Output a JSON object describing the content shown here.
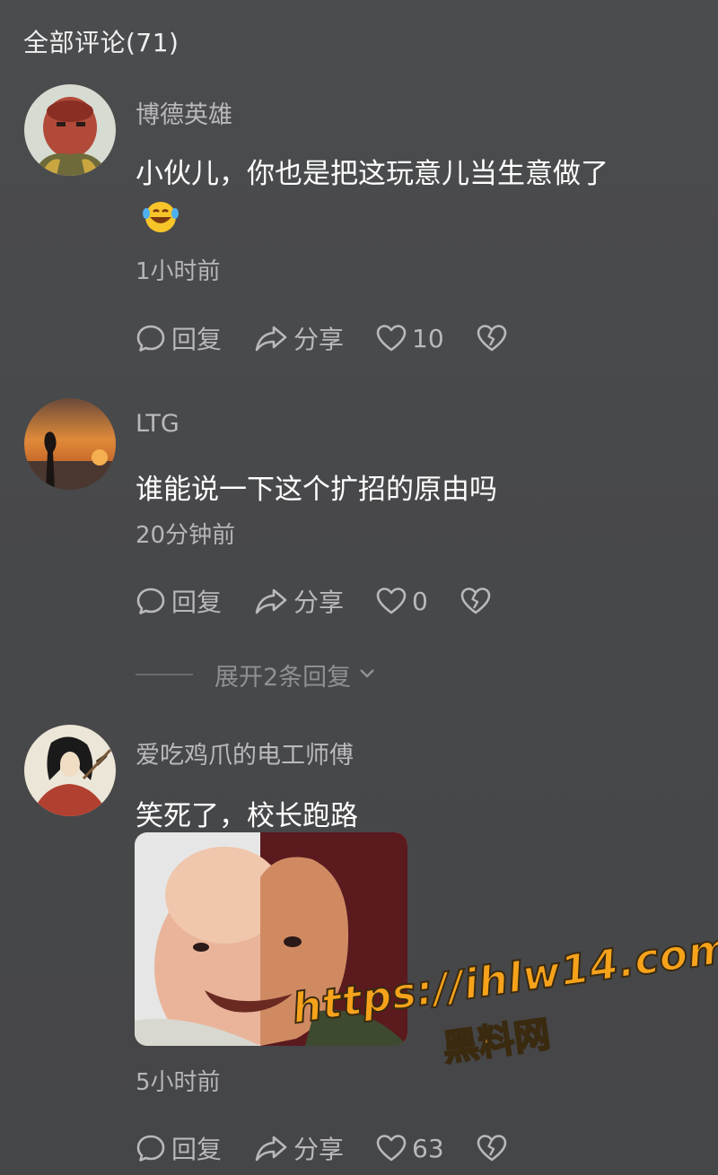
{
  "header": {
    "title": "全部评论(71)"
  },
  "comments": [
    {
      "username": "博德英雄",
      "text": "小伙儿，你也是把这玩意儿当生意做了",
      "emoji": "laughing-tears-emoji",
      "time": "1小时前",
      "reply_label": "回复",
      "share_label": "分享",
      "likes": "10"
    },
    {
      "username": "LTG",
      "text": "谁能说一下这个扩招的原由吗",
      "time": "20分钟前",
      "reply_label": "回复",
      "share_label": "分享",
      "likes": "0",
      "expand_label": "展开2条回复"
    },
    {
      "username": "爱吃鸡爪的电工师傅",
      "text": "笑死了，校长跑路",
      "image": "meme-image",
      "time": "5小时前",
      "reply_label": "回复",
      "share_label": "分享",
      "likes": "63"
    }
  ],
  "watermark": {
    "url": "https://ihlw14.com",
    "site": "黑料网"
  },
  "colors": {
    "background": "#4a4b4d",
    "text_primary": "#ffffff",
    "text_secondary": "#b9b9bb",
    "watermark": "#f6a21b"
  },
  "icons": [
    "comment-bubble-icon",
    "share-arrow-icon",
    "heart-icon",
    "broken-heart-icon",
    "chevron-down-icon"
  ]
}
